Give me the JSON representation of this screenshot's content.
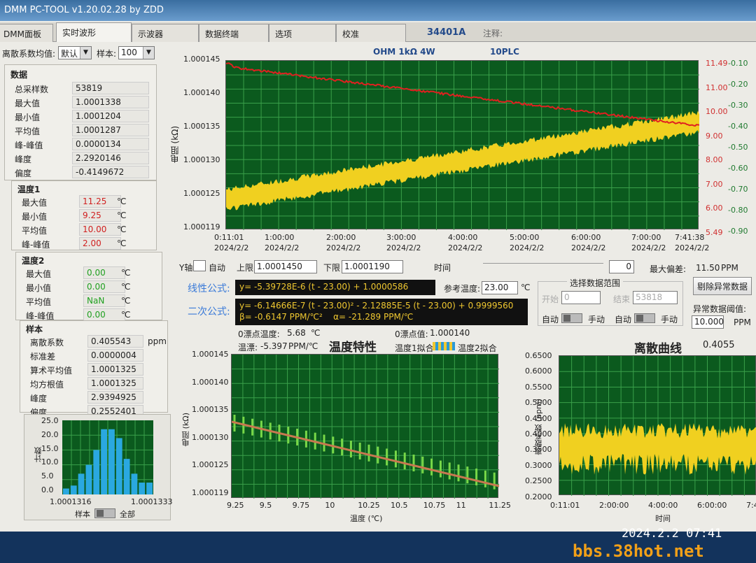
{
  "window": {
    "title": "DMM PC-TOOL v1.20.02.28 by ZDD"
  },
  "tabs": [
    "DMM面板",
    "实时波形",
    "示波器",
    "数据终端",
    "选项",
    "校准"
  ],
  "header": {
    "model": "34401A",
    "note_label": "注释:",
    "mode": "OHM  1kΩ 4W",
    "plc": "10PLC"
  },
  "toolbar": {
    "discrete_label": "离散系数均值:",
    "discrete_value": "默认",
    "sample_label": "样本:",
    "sample_value": "100"
  },
  "data_panel": {
    "title": "数据",
    "rows": [
      {
        "label": "总采样数",
        "value": "53819"
      },
      {
        "label": "最大值",
        "value": "1.0001338"
      },
      {
        "label": "最小值",
        "value": "1.0001204"
      },
      {
        "label": "平均值",
        "value": "1.0001287"
      },
      {
        "label": "峰-峰值",
        "value": "0.0000134"
      },
      {
        "label": "峰度",
        "value": "2.2920146"
      },
      {
        "label": "偏度",
        "value": "-0.4149672"
      }
    ]
  },
  "temp1": {
    "title": "温度1",
    "unit": "℃",
    "rows": [
      {
        "label": "最大值",
        "value": "11.25"
      },
      {
        "label": "最小值",
        "value": "9.25"
      },
      {
        "label": "平均值",
        "value": "10.00"
      },
      {
        "label": "峰-峰值",
        "value": "2.00"
      }
    ]
  },
  "temp2": {
    "title": "温度2",
    "unit": "℃",
    "rows": [
      {
        "label": "最大值",
        "value": "0.00"
      },
      {
        "label": "最小值",
        "value": "0.00"
      },
      {
        "label": "平均值",
        "value": "NaN"
      },
      {
        "label": "峰-峰值",
        "value": "0.00"
      }
    ]
  },
  "sample_panel": {
    "title": "样本",
    "rows": [
      {
        "label": "离散系数",
        "value": "0.405543",
        "unit": "ppm"
      },
      {
        "label": "标准差",
        "value": "0.0000004",
        "unit": ""
      },
      {
        "label": "算术平均值",
        "value": "1.0001325",
        "unit": ""
      },
      {
        "label": "均方根值",
        "value": "1.0001325",
        "unit": ""
      },
      {
        "label": "峰度",
        "value": "2.9394925",
        "unit": ""
      },
      {
        "label": "偏度",
        "value": "0.2552401",
        "unit": ""
      }
    ]
  },
  "histogram": {
    "ylabel": "计数",
    "yticks": [
      "25.0",
      "20.0",
      "15.0",
      "10.0",
      "5.0",
      "0.0"
    ],
    "xmin": "1.0001316",
    "xmax": "1.0001333",
    "counts": [
      2,
      3,
      7,
      10,
      15,
      22,
      22,
      19,
      12,
      7,
      4,
      4
    ],
    "toggle_left": "样本",
    "toggle_right": "全部"
  },
  "main_chart": {
    "ylabel": "电阻 (kΩ)",
    "yticks": [
      "1.000145",
      "1.000140",
      "1.000135",
      "1.000130",
      "1.000125",
      "1.000119"
    ],
    "right_ticks_red": [
      "11.49",
      "11.00",
      "10.00",
      "9.00",
      "8.00",
      "7.00",
      "6.00",
      "5.49"
    ],
    "right_ticks_green": [
      "-0.10",
      "-0.20",
      "-0.30",
      "-0.40",
      "-0.50",
      "-0.60",
      "-0.70",
      "-0.80",
      "-0.90"
    ],
    "xticks": [
      {
        "t": "0:11:01",
        "d": "2024/2/2"
      },
      {
        "t": "1:00:00",
        "d": "2024/2/2"
      },
      {
        "t": "2:00:00",
        "d": "2024/2/2"
      },
      {
        "t": "3:00:00",
        "d": "2024/2/2"
      },
      {
        "t": "4:00:00",
        "d": "2024/2/2"
      },
      {
        "t": "5:00:00",
        "d": "2024/2/2"
      },
      {
        "t": "6:00:00",
        "d": "2024/2/2"
      },
      {
        "t": "7:00:00",
        "d": "2024/2/2"
      },
      {
        "t": "7:41:38",
        "d": "2024/2/2"
      }
    ]
  },
  "controls": {
    "yaxis": "Y轴",
    "auto": "自动",
    "upper_label": "上限",
    "upper": "1.0001450",
    "lower_label": "下限",
    "lower": "1.0001190",
    "time_label": "时间",
    "time_value": "0",
    "max_dev_label": "最大偏差:",
    "max_dev": "11.50",
    "ppm": "PPM"
  },
  "formulas": {
    "linear_label": "线性公式:",
    "linear": "y= -5.39728E-6 (t - 23.00) + 1.0000586",
    "quad_label": "二次公式:",
    "quad": "y= -6.14666E-7 (t - 23.00)² - 2.12885E-5 (t - 23.00) + 0.9999560",
    "beta": "β=  -0.6147  PPM/℃²",
    "alpha": "α=  -21.289  PPM/℃",
    "ref_temp_label": "参考温度:",
    "ref_temp": "23.00",
    "ref_unit": "℃"
  },
  "range": {
    "title": "选择数据范围",
    "start_label": "开始",
    "start": "0",
    "end_label": "结束",
    "end": "53818",
    "auto": "自动",
    "manual": "手动"
  },
  "anomaly": {
    "btn": "剔除异常数据",
    "threshold_label": "异常数据阈值:",
    "threshold": "10.000",
    "unit": "PPM"
  },
  "drift": {
    "zero1_label": "0漂点温度:",
    "zero1": "5.68",
    "zero1_unit": "℃",
    "zero2_label": "0漂点值:",
    "zero2": "1.000140",
    "tdrift_label": "温漂:",
    "tdrift": "-5.397",
    "tdrift_unit": "PPM/℃",
    "title": "温度特性",
    "legend1": "温度1拟合",
    "legend2": "温度2拟合"
  },
  "temp_chart": {
    "ylabel": "电阻 (kΩ)",
    "xlabel": "温度 (℃)",
    "yticks": [
      "1.000145",
      "1.000140",
      "1.000135",
      "1.000130",
      "1.000125",
      "1.000119"
    ],
    "xticks": [
      "9.25",
      "9.5",
      "9.75",
      "10",
      "10.25",
      "10.5",
      "10.75",
      "11",
      "11.25"
    ]
  },
  "disc_chart": {
    "title": "离散曲线",
    "value": "0.4055",
    "ylabel": "离散系数 (ppm)",
    "xlabel": "时间",
    "yticks": [
      "0.6500",
      "0.6000",
      "0.5500",
      "0.5000",
      "0.4500",
      "0.4000",
      "0.3500",
      "0.3000",
      "0.2500",
      "0.2000"
    ],
    "xticks": [
      "0:11:01",
      "2:00:00",
      "4:00:00",
      "6:00:00",
      "7:4"
    ]
  },
  "overlay": {
    "timestamp": "2024.2.2  07:41",
    "watermark": "bbs.38hot.net"
  },
  "colors": {
    "plot_bg": "#0b5a1e",
    "grid": "#3aa04a",
    "trace": "#f0d020",
    "temp": "#e02020",
    "fit": "#c87850"
  }
}
